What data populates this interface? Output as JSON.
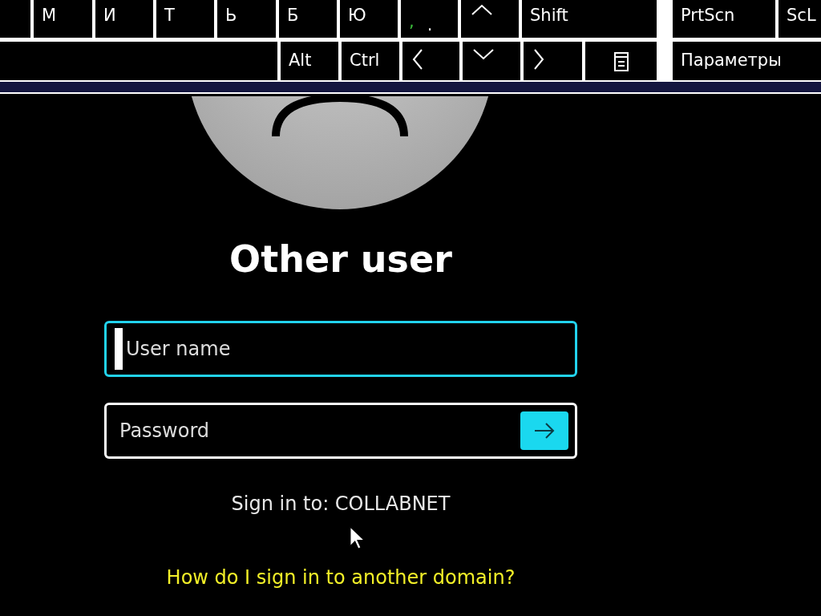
{
  "keyboard": {
    "top_row_keys": [
      {
        "kind": "blank"
      },
      {
        "kind": "text",
        "label": "М"
      },
      {
        "kind": "text",
        "label": "И"
      },
      {
        "kind": "text",
        "label": "Т"
      },
      {
        "kind": "text",
        "label": "Ь"
      },
      {
        "kind": "text",
        "label": "Б"
      },
      {
        "kind": "text",
        "label": "Ю"
      },
      {
        "kind": "dual",
        "label": ",",
        "secondary": "."
      },
      {
        "kind": "up"
      },
      {
        "kind": "text",
        "label": "Shift"
      },
      {
        "kind": "gap"
      },
      {
        "kind": "text",
        "label": "PrtScn"
      },
      {
        "kind": "text",
        "label": "ScL"
      }
    ],
    "bottom_row_keys": [
      {
        "kind": "blank"
      },
      {
        "kind": "text",
        "label": "Alt"
      },
      {
        "kind": "text",
        "label": "Ctrl"
      },
      {
        "kind": "left"
      },
      {
        "kind": "down"
      },
      {
        "kind": "right"
      },
      {
        "kind": "menu"
      },
      {
        "kind": "gap"
      },
      {
        "kind": "text",
        "label": "Параметры"
      }
    ]
  },
  "login": {
    "title": "Other user",
    "username": {
      "placeholder": "User name",
      "focused": true
    },
    "password": {
      "placeholder": "Password",
      "focused": false
    },
    "sign_in_to": "Sign in to: COLLABNET",
    "help_link": "How do I sign in to another domain?"
  }
}
